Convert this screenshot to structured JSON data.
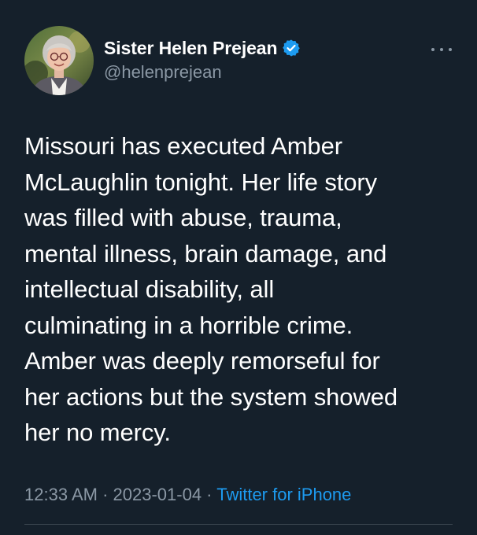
{
  "author": {
    "display_name": "Sister Helen Prejean",
    "handle": "@helenprejean",
    "verified": true
  },
  "icons": {
    "verified": "verified-badge-icon",
    "more": "more-options-icon"
  },
  "tweet": {
    "text": "Missouri has executed Amber\nMcLaughlin tonight. Her life story\nwas filled with abuse, trauma,\nmental illness, brain damage, and\nintellectual disability, all\nculminating in a horrible crime.\nAmber was deeply remorseful for\nher actions but the system showed\nher no mercy."
  },
  "meta": {
    "time": "12:33 AM",
    "separator": " · ",
    "date": "2023-01-04",
    "source": "Twitter for iPhone"
  },
  "colors": {
    "background": "#15202b",
    "accent": "#1d9bf0",
    "secondary_text": "#8b98a5"
  }
}
